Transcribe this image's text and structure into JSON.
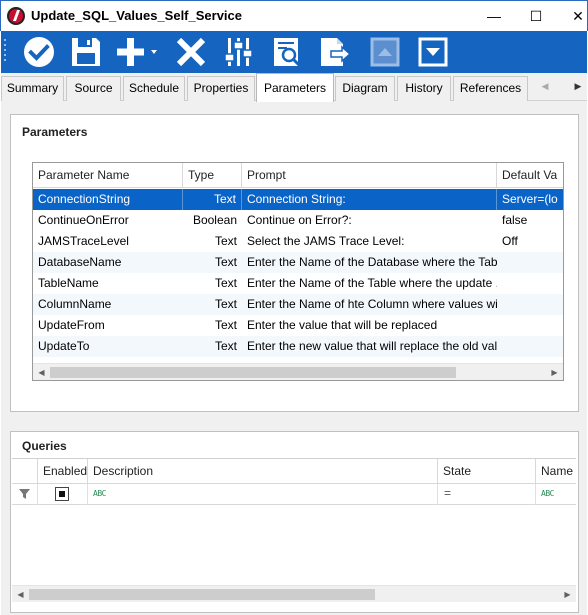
{
  "window": {
    "title": "Update_SQL_Values_Self_Service",
    "controls": {
      "minimize": "—",
      "maximize": "☐",
      "close": "✕"
    }
  },
  "toolbar": {
    "items": [
      {
        "name": "save-close",
        "icon": "check-circle-icon"
      },
      {
        "name": "save",
        "icon": "floppy-icon"
      },
      {
        "name": "add",
        "icon": "plus-dropdown-icon"
      },
      {
        "name": "delete",
        "icon": "x-icon"
      },
      {
        "name": "adjust",
        "icon": "sliders-icon"
      },
      {
        "name": "preview",
        "icon": "search-document-icon"
      },
      {
        "name": "export",
        "icon": "export-document-icon"
      },
      {
        "name": "move-up",
        "icon": "arrow-up-box-icon",
        "enabled": false
      },
      {
        "name": "move-down",
        "icon": "arrow-down-box-icon",
        "enabled": true
      }
    ]
  },
  "tabs": [
    {
      "label": "Summary"
    },
    {
      "label": "Source"
    },
    {
      "label": "Schedule"
    },
    {
      "label": "Properties"
    },
    {
      "label": "Parameters",
      "active": true
    },
    {
      "label": "Diagram"
    },
    {
      "label": "History"
    },
    {
      "label": "References"
    }
  ],
  "tab_scroll": {
    "left": "◀",
    "right": "▶"
  },
  "parameters": {
    "title": "Parameters",
    "columns": [
      "Parameter Name",
      "Type",
      "Prompt",
      "Default Va"
    ],
    "rows": [
      {
        "name": "ConnectionString",
        "type": "Text",
        "prompt": "Connection String:",
        "default": "Server=(lo",
        "selected": true
      },
      {
        "name": "ContinueOnError",
        "type": "Boolean",
        "prompt": "Continue on Error?:",
        "default": "false"
      },
      {
        "name": "JAMSTraceLevel",
        "type": "Text",
        "prompt": "Select the JAMS Trace Level:",
        "default": "Off"
      },
      {
        "name": "DatabaseName",
        "type": "Text",
        "prompt": "Enter the Name of the Database where the Table ...",
        "default": ""
      },
      {
        "name": "TableName",
        "type": "Text",
        "prompt": "Enter the Name of the Table where the update ...",
        "default": ""
      },
      {
        "name": "ColumnName",
        "type": "Text",
        "prompt": "Enter the Name of hte Column where values will ...",
        "default": ""
      },
      {
        "name": "UpdateFrom",
        "type": "Text",
        "prompt": "Enter the value that will be replaced",
        "default": ""
      },
      {
        "name": "UpdateTo",
        "type": "Text",
        "prompt": "Enter the new value that will replace the old value",
        "default": ""
      }
    ],
    "scroll": {
      "left": "◀",
      "right": "▶"
    }
  },
  "queries": {
    "title": "Queries",
    "columns": [
      "Enabled",
      "Description",
      "State",
      "Name"
    ],
    "filter": {
      "abc": "ABC",
      "equals": "="
    },
    "scroll": {
      "left": "◀",
      "right": "▶"
    }
  },
  "colors": {
    "toolbar": "#1565c0",
    "selection": "#0a64c8",
    "accent_border": "#2b6ac0"
  }
}
